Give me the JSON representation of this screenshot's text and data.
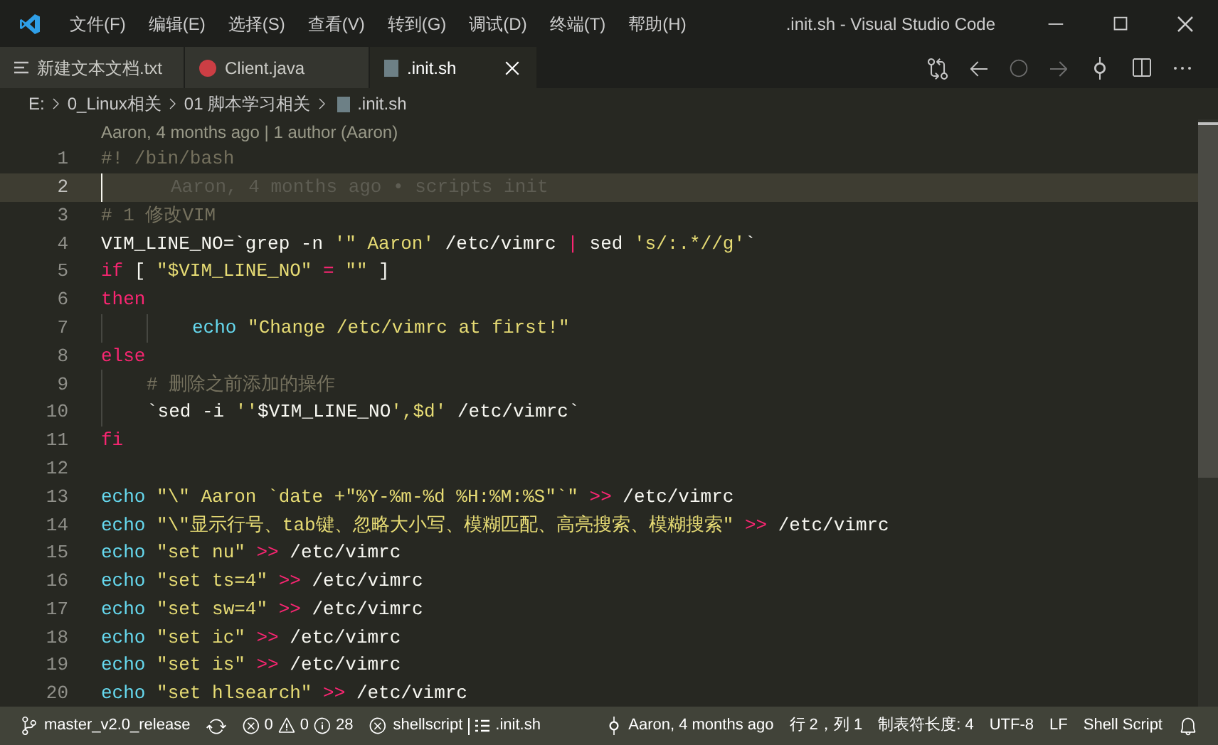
{
  "window": {
    "title": ".init.sh - Visual Studio Code"
  },
  "menu": [
    "文件(F)",
    "编辑(E)",
    "选择(S)",
    "查看(V)",
    "转到(G)",
    "调试(D)",
    "终端(T)",
    "帮助(H)"
  ],
  "tabs": [
    {
      "label": "新建文本文档.txt",
      "kind": "text",
      "selected": false
    },
    {
      "label": "Client.java",
      "kind": "java",
      "selected": false
    },
    {
      "label": ".init.sh",
      "kind": "shell",
      "selected": true
    }
  ],
  "breadcrumb": [
    "E:",
    "0_Linux相关",
    "01 脚本学习相关",
    ".init.sh"
  ],
  "codelens": "Aaron, 4 months ago | 1 author (Aaron)",
  "lines": [
    {
      "number": "1",
      "current": false,
      "indented": false,
      "double_indent": false,
      "tokens": [
        {
          "kind": "comment",
          "text": "#! /bin/bash"
        }
      ]
    },
    {
      "number": "2",
      "current": true,
      "indented": false,
      "double_indent": false,
      "tokens": [
        {
          "kind": "blame",
          "text": "Aaron, 4 months ago • scripts init"
        }
      ]
    },
    {
      "number": "3",
      "current": false,
      "indented": false,
      "double_indent": false,
      "tokens": [
        {
          "kind": "comment",
          "text": "# 1 修改VIM"
        }
      ]
    },
    {
      "number": "4",
      "current": false,
      "indented": false,
      "double_indent": false,
      "tokens": [
        {
          "kind": "plain",
          "text": "VIM_LINE_NO=`grep -n "
        },
        {
          "kind": "string",
          "text": "'\" Aaron'"
        },
        {
          "kind": "plain",
          "text": " /etc/vimrc "
        },
        {
          "kind": "keyword",
          "text": "|"
        },
        {
          "kind": "plain",
          "text": " sed "
        },
        {
          "kind": "string",
          "text": "'s/:.*//g'"
        },
        {
          "kind": "plain",
          "text": "`"
        }
      ]
    },
    {
      "number": "5",
      "current": false,
      "indented": false,
      "double_indent": false,
      "tokens": [
        {
          "kind": "keyword",
          "text": "if"
        },
        {
          "kind": "plain",
          "text": " [ "
        },
        {
          "kind": "string",
          "text": "\"$VIM_LINE_NO\""
        },
        {
          "kind": "keyword",
          "text": " = "
        },
        {
          "kind": "string",
          "text": "\"\""
        },
        {
          "kind": "plain",
          "text": " ]"
        }
      ]
    },
    {
      "number": "6",
      "current": false,
      "indented": false,
      "double_indent": false,
      "tokens": [
        {
          "kind": "keyword",
          "text": "then"
        }
      ]
    },
    {
      "number": "7",
      "current": false,
      "indented": true,
      "double_indent": true,
      "tokens": [
        {
          "kind": "builtin",
          "text": "echo"
        },
        {
          "kind": "string",
          "text": " \"Change /etc/vimrc at first!\""
        }
      ]
    },
    {
      "number": "8",
      "current": false,
      "indented": false,
      "double_indent": false,
      "tokens": [
        {
          "kind": "keyword",
          "text": "else"
        }
      ]
    },
    {
      "number": "9",
      "current": false,
      "indented": true,
      "double_indent": false,
      "tokens": [
        {
          "kind": "comment",
          "text": "# 删除之前添加的操作"
        }
      ]
    },
    {
      "number": "10",
      "current": false,
      "indented": true,
      "double_indent": false,
      "tokens": [
        {
          "kind": "plain",
          "text": "`sed -i "
        },
        {
          "kind": "string",
          "text": "''"
        },
        {
          "kind": "plain",
          "text": "$VIM_LINE_NO"
        },
        {
          "kind": "string",
          "text": "',$d'"
        },
        {
          "kind": "plain",
          "text": " /etc/vimrc`"
        }
      ]
    },
    {
      "number": "11",
      "current": false,
      "indented": false,
      "double_indent": false,
      "tokens": [
        {
          "kind": "keyword",
          "text": "fi"
        }
      ]
    },
    {
      "number": "12",
      "current": false,
      "indented": false,
      "double_indent": false
    },
    {
      "number": "13",
      "current": false,
      "indented": false,
      "double_indent": false,
      "tokens": [
        {
          "kind": "builtin",
          "text": "echo"
        },
        {
          "kind": "string",
          "text": " \"\\\" Aaron `date +\"%Y-%m-%d %H:%M:%S\"`\""
        },
        {
          "kind": "keyword",
          "text": " >>"
        },
        {
          "kind": "plain",
          "text": " /etc/vimrc"
        }
      ]
    },
    {
      "number": "14",
      "current": false,
      "indented": false,
      "double_indent": false,
      "tokens": [
        {
          "kind": "builtin",
          "text": "echo"
        },
        {
          "kind": "string",
          "text": " \"\\\"显示行号、tab键、忽略大小写、模糊匹配、高亮搜索、模糊搜索\""
        },
        {
          "kind": "keyword",
          "text": " >>"
        },
        {
          "kind": "plain",
          "text": " /etc/vimrc"
        }
      ]
    },
    {
      "number": "15",
      "current": false,
      "indented": false,
      "double_indent": false,
      "tokens": [
        {
          "kind": "builtin",
          "text": "echo"
        },
        {
          "kind": "string",
          "text": " \"set nu\""
        },
        {
          "kind": "keyword",
          "text": " >>"
        },
        {
          "kind": "plain",
          "text": " /etc/vimrc"
        }
      ]
    },
    {
      "number": "16",
      "current": false,
      "indented": false,
      "double_indent": false,
      "tokens": [
        {
          "kind": "builtin",
          "text": "echo"
        },
        {
          "kind": "string",
          "text": " \"set ts=4\""
        },
        {
          "kind": "keyword",
          "text": " >>"
        },
        {
          "kind": "plain",
          "text": " /etc/vimrc"
        }
      ]
    },
    {
      "number": "17",
      "current": false,
      "indented": false,
      "double_indent": false,
      "tokens": [
        {
          "kind": "builtin",
          "text": "echo"
        },
        {
          "kind": "string",
          "text": " \"set sw=4\""
        },
        {
          "kind": "keyword",
          "text": " >>"
        },
        {
          "kind": "plain",
          "text": " /etc/vimrc"
        }
      ]
    },
    {
      "number": "18",
      "current": false,
      "indented": false,
      "double_indent": false,
      "tokens": [
        {
          "kind": "builtin",
          "text": "echo"
        },
        {
          "kind": "string",
          "text": " \"set ic\""
        },
        {
          "kind": "keyword",
          "text": " >>"
        },
        {
          "kind": "plain",
          "text": " /etc/vimrc"
        }
      ]
    },
    {
      "number": "19",
      "current": false,
      "indented": false,
      "double_indent": false,
      "tokens": [
        {
          "kind": "builtin",
          "text": "echo"
        },
        {
          "kind": "string",
          "text": " \"set is\""
        },
        {
          "kind": "keyword",
          "text": " >>"
        },
        {
          "kind": "plain",
          "text": " /etc/vimrc"
        }
      ]
    },
    {
      "number": "20",
      "current": false,
      "indented": false,
      "double_indent": false,
      "tokens": [
        {
          "kind": "builtin",
          "text": "echo"
        },
        {
          "kind": "string",
          "text": " \"set hlsearch\""
        },
        {
          "kind": "keyword",
          "text": " >>"
        },
        {
          "kind": "plain",
          "text": " /etc/vimrc"
        }
      ]
    }
  ],
  "status_bar": {
    "branch": "master_v2.0_release",
    "errors": "0",
    "warnings": "0",
    "infos": "28",
    "linter": "shellscript",
    "file": ".init.sh",
    "blame": "Aaron, 4 months ago",
    "position": "行 2，列 1",
    "tab_size": "制表符长度: 4",
    "encoding": "UTF-8",
    "eol": "LF",
    "language": "Shell Script"
  }
}
